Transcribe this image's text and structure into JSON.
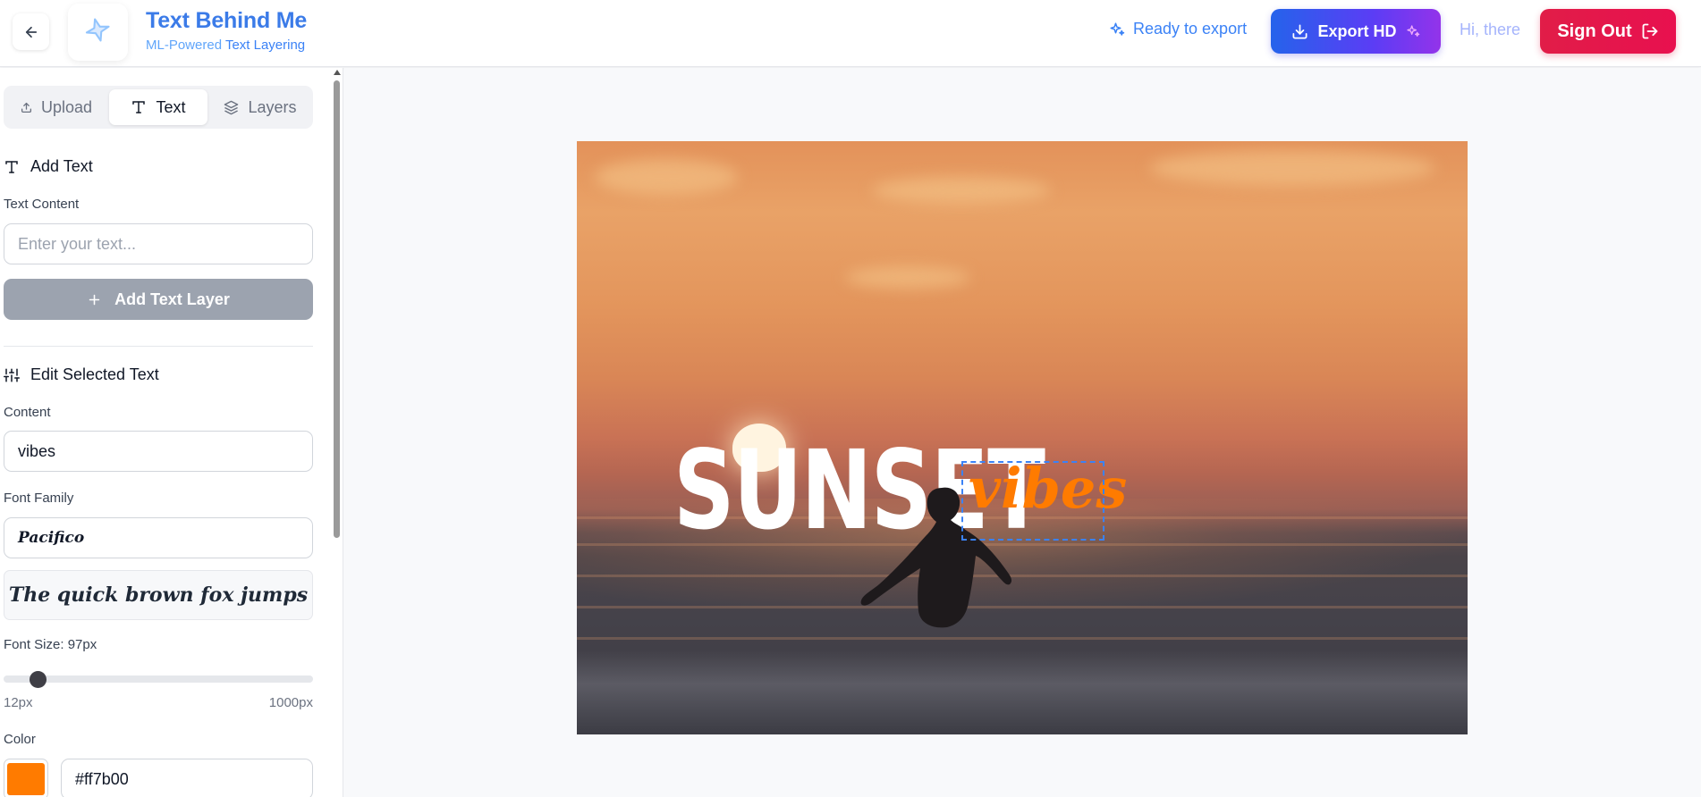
{
  "header": {
    "brand_title": "Text Behind Me",
    "brand_sub_a": "ML-Powered ",
    "brand_sub_b": "Text Layering",
    "status": "Ready to export",
    "export_label": "Export HD",
    "greeting": "Hi, there",
    "signout_label": "Sign Out"
  },
  "sidebar": {
    "tabs": [
      {
        "label": "Upload",
        "icon": "upload-icon"
      },
      {
        "label": "Text",
        "icon": "type-icon",
        "active": true
      },
      {
        "label": "Layers",
        "icon": "layers-icon"
      }
    ],
    "add_text": {
      "title": "Add Text",
      "content_label": "Text Content",
      "placeholder": "Enter your text...",
      "add_button": "Add Text Layer"
    },
    "edit": {
      "title": "Edit Selected Text",
      "content_label": "Content",
      "content_value": "vibes",
      "font_family_label": "Font Family",
      "font_family_value": "Pacifico",
      "preview_text": "The quick brown fox jumps",
      "font_size_label": "Font Size: 97px",
      "font_size_value": 97,
      "font_size_min": "12px",
      "font_size_max": "1000px",
      "color_label": "Color",
      "color_value": "#ff7b00"
    }
  },
  "canvas": {
    "background_text": "SUNSET",
    "selected_text": "vibes",
    "selected_color": "#ff7b00"
  },
  "colors": {
    "accent": "#3b82f6",
    "export_gradient": [
      "#2563eb",
      "#9333ea"
    ],
    "signout": "#e11d48"
  }
}
